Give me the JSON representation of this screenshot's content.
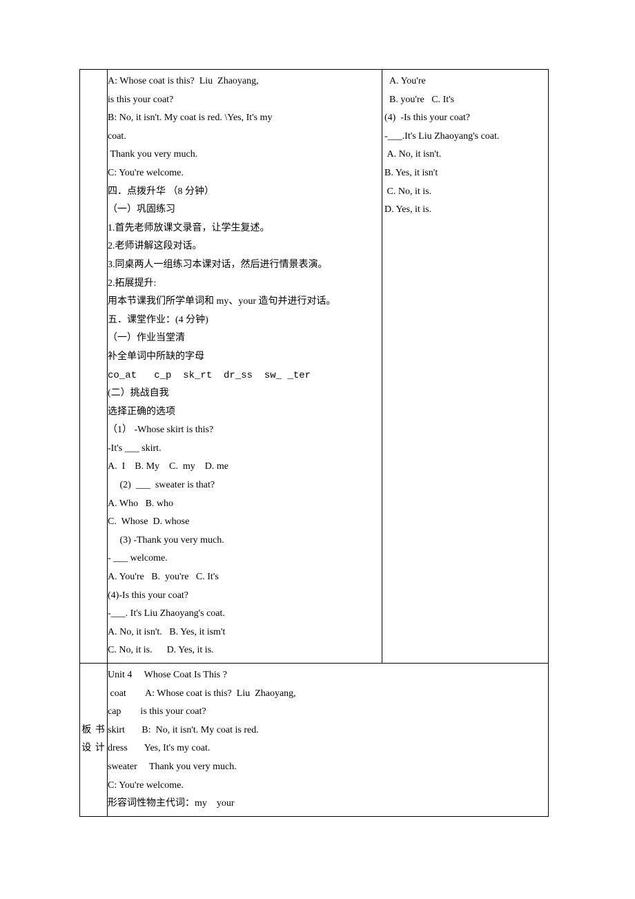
{
  "main": {
    "center_lines": [
      "A: Whose coat is this?  Liu  Zhaoyang,",
      "is this your coat?",
      "B: No, it isn't. My coat is red. \\Yes, It's my",
      "coat.",
      " Thank you very much.",
      "C: You're welcome.",
      "",
      "四．点拨升华 （8 分钟）",
      "",
      "（一）巩固练习",
      "1.首先老师放课文录音，让学生复述。",
      "2.老师讲解这段对话。",
      "3.同桌两人一组练习本课对话，然后进行情景表演。",
      "2.拓展提升:",
      "用本节课我们所学单词和 my、your 造句并进行对话。",
      "五．课堂作业：(4 分钟)",
      "（一）作业当堂清",
      "补全单词中所缺的字母",
      "co_at   c_p  sk_rt  dr_ss  sw_ _ter",
      "(二）挑战自我",
      "选择正确的选项",
      "（1） -Whose skirt is this?",
      "-It's ___ skirt.",
      "A.  I    B. My    C.  my    D. me",
      "     (2)  ___  sweater is that?",
      "A. Who   B. who",
      "C.  Whose  D. whose",
      "     (3) -Thank you very much.",
      "- ___ welcome.",
      "A. You're   B.  you're   C. It's",
      "(4)-Is this your coat?",
      "-___. It's Liu Zhaoyang's coat.",
      "A. No, it isn't.   B. Yes, it ism't",
      "C. No, it is.      D. Yes, it is."
    ],
    "right_lines": [
      "  A. You're",
      "  B. you're   C. It's",
      "(4)  -Is this your coat?",
      "-___.It's Liu Zhaoyang's coat.",
      " A. No, it isn't.",
      "B. Yes, it isn't",
      " C. No, it is.",
      "D. Yes, it is."
    ]
  },
  "banshu": {
    "label_line1": "板 书",
    "label_line2": "设 计",
    "content_lines": [
      "Unit 4     Whose Coat Is This ?",
      " coat        A: Whose coat is this?  Liu  Zhaoyang,",
      "cap        is this your coat?",
      "skirt       B:  No, it isn't. My coat is red.",
      "dress       Yes, It's my coat.",
      "sweater     Thank you very much.",
      "C: You're welcome.",
      "形容词性物主代词：my    your"
    ]
  }
}
